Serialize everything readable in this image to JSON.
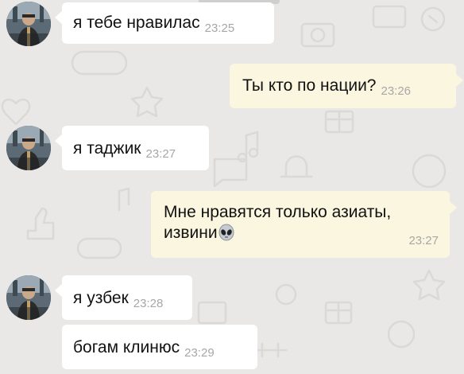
{
  "colors": {
    "background": "#e9e8e6",
    "incoming_bubble": "#ffffff",
    "outgoing_bubble": "#fbf6df",
    "timestamp": "#a7a7a7"
  },
  "messages": [
    {
      "direction": "incoming",
      "text": "я тебе нравилас",
      "time": "23:25"
    },
    {
      "direction": "outgoing",
      "text": "Ты кто по нации?",
      "time": "23:26"
    },
    {
      "direction": "incoming",
      "text": "я таджик",
      "time": "23:27"
    },
    {
      "direction": "outgoing",
      "line1": "Мне нравятся только азиаты,",
      "line2": "извини",
      "emoji": "alien-face-icon",
      "time": "23:27"
    },
    {
      "direction": "incoming",
      "text": "я узбек",
      "time": "23:28"
    },
    {
      "direction": "incoming",
      "text": "богам клинюс",
      "time": "23:29"
    }
  ]
}
